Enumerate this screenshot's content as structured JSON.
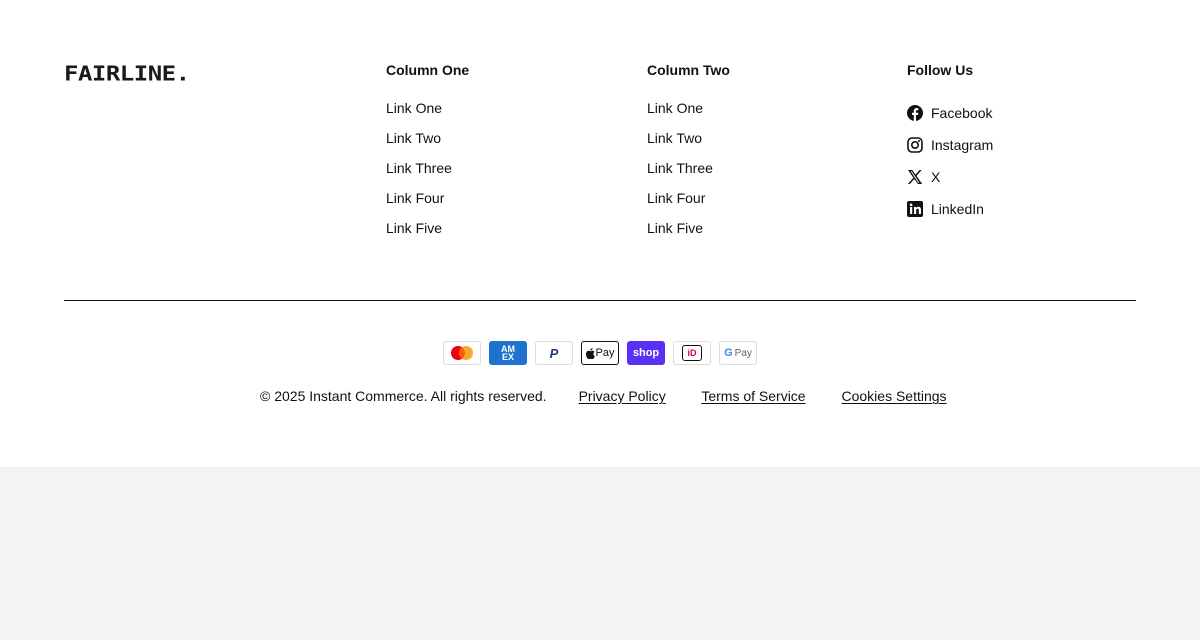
{
  "brand": {
    "logo_text": "FAIRLINE."
  },
  "columns": [
    {
      "title": "Column One",
      "links": [
        "Link One",
        "Link Two",
        "Link Three",
        "Link Four",
        "Link Five"
      ]
    },
    {
      "title": "Column Two",
      "links": [
        "Link One",
        "Link Two",
        "Link Three",
        "Link Four",
        "Link Five"
      ]
    }
  ],
  "follow": {
    "title": "Follow Us",
    "items": [
      {
        "label": "Facebook",
        "icon": "facebook-icon"
      },
      {
        "label": "Instagram",
        "icon": "instagram-icon"
      },
      {
        "label": "X",
        "icon": "x-icon"
      },
      {
        "label": "LinkedIn",
        "icon": "linkedin-icon"
      }
    ]
  },
  "payments": [
    {
      "icon": "mastercard-icon"
    },
    {
      "icon": "american-express-icon",
      "text": "AM EX"
    },
    {
      "icon": "paypal-icon",
      "text": "P"
    },
    {
      "icon": "apple-pay-icon",
      "text": "Pay"
    },
    {
      "icon": "shop-pay-icon",
      "text": "shop"
    },
    {
      "icon": "ideal-icon",
      "text": "iD"
    },
    {
      "icon": "google-pay-icon",
      "text": "Pay"
    }
  ],
  "bottom": {
    "copyright": "© 2025 Instant Commerce. All rights reserved.",
    "links": [
      "Privacy Policy",
      "Terms of Service",
      "Cookies Settings"
    ]
  },
  "colors": {
    "text": "#111111",
    "page_background": "#f3f3f5",
    "footer_background": "#ffffff",
    "amex_blue": "#1f72cd",
    "shop_pay_purple": "#5a31f4",
    "ideal_pink": "#cc0066",
    "mastercard_red": "#eb001b",
    "mastercard_orange": "#f79e1b"
  }
}
